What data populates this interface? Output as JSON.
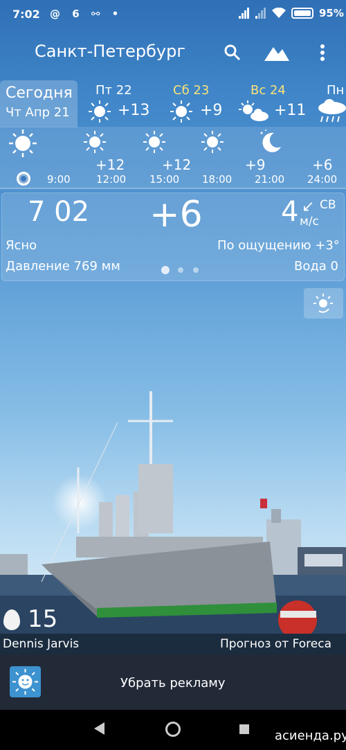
{
  "status_bar": {
    "time": "7:02",
    "left_icons": "@ 6 ⚯ •",
    "battery_pct": "95%"
  },
  "app_bar": {
    "city": "Санкт-Петербург",
    "icons": [
      "search-icon",
      "landscape-icon",
      "menu-icon"
    ]
  },
  "days": {
    "today": {
      "label": "Сегодня",
      "date": "Чт Апр 21"
    },
    "items": [
      {
        "name": "Пт 22",
        "temp": "+13",
        "icon": "sun-icon",
        "weekend": false
      },
      {
        "name": "Сб 23",
        "temp": "+9",
        "icon": "sun-icon",
        "weekend": true
      },
      {
        "name": "Вс 24",
        "temp": "+11",
        "icon": "sun-cloud-icon",
        "weekend": true
      },
      {
        "name": "Пн",
        "temp": "",
        "icon": "rain-icon",
        "weekend": false
      }
    ]
  },
  "hourly": [
    {
      "time": "9:00",
      "temp": ""
    },
    {
      "time": "12:00",
      "temp": "+12"
    },
    {
      "time": "15:00",
      "temp": "+12"
    },
    {
      "time": "18:00",
      "temp": ""
    },
    {
      "time": "21:00",
      "temp": "+9"
    },
    {
      "time": "24:00",
      "temp": "+6"
    }
  ],
  "current": {
    "time": "7 02",
    "temp": "+6",
    "wind_speed": "4",
    "wind_dir": "СВ",
    "wind_unit": "м/с",
    "condition": "Ясно",
    "feels_like": "По ощущению +3°",
    "pressure": "Давление 769 мм",
    "water": "Вода 0"
  },
  "photo": {
    "number": "15",
    "author": "Dennis Jarvis",
    "source": "Прогноз от Foreca"
  },
  "ad": {
    "text": "Убрать рекламу"
  },
  "watermark": "асиенда.ру",
  "colors": {
    "weekend": "#f8e27a",
    "ad_bar": "#222a38",
    "credits_bar": "#1c2c3f"
  }
}
